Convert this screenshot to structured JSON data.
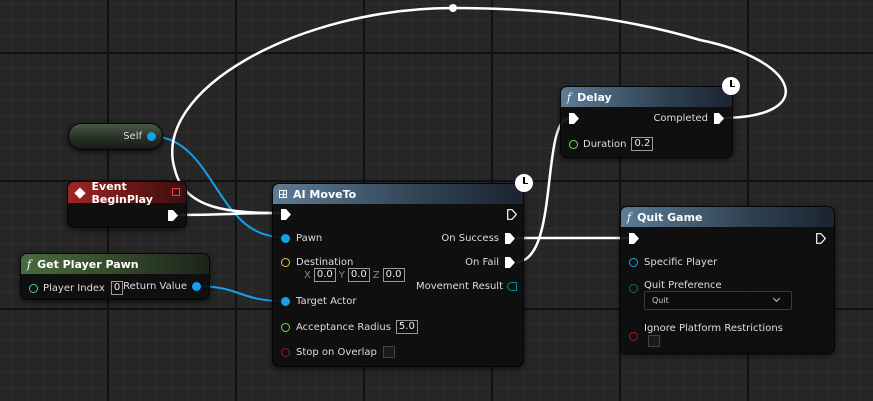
{
  "nodes": {
    "self": {
      "label": "Self"
    },
    "event_begin_play": {
      "title": "Event BeginPlay"
    },
    "get_player_pawn": {
      "title": "Get Player Pawn",
      "player_index_label": "Player Index",
      "player_index_value": "0",
      "return_value_label": "Return Value"
    },
    "ai_move_to": {
      "title": "AI MoveTo",
      "pawn_label": "Pawn",
      "destination_label": "Destination",
      "dest_x_label": "X",
      "dest_x": "0.0",
      "dest_y_label": "Y",
      "dest_y": "0.0",
      "dest_z_label": "Z",
      "dest_z": "0.0",
      "target_actor_label": "Target Actor",
      "acceptance_radius_label": "Acceptance Radius",
      "acceptance_radius_value": "5.0",
      "stop_on_overlap_label": "Stop on Overlap",
      "on_success_label": "On Success",
      "on_fail_label": "On Fail",
      "movement_result_label": "Movement Result"
    },
    "delay": {
      "title": "Delay",
      "completed_label": "Completed",
      "duration_label": "Duration",
      "duration_value": "0.2"
    },
    "quit_game": {
      "title": "Quit Game",
      "specific_player_label": "Specific Player",
      "quit_preference_label": "Quit Preference",
      "quit_preference_value": "Quit",
      "ignore_restrictions_label": "Ignore Platform Restrictions"
    }
  },
  "colors": {
    "object_pin": "#15a0ec",
    "float_pin": "#6fe04a",
    "vector_pin": "#f3c33b",
    "bool_pin": "#a61a1a",
    "enum_pin": "#0b6b6b",
    "int_pin": "#3fd6a0",
    "exec_wire": "#ffffff",
    "canvas_bg": "#262626"
  }
}
